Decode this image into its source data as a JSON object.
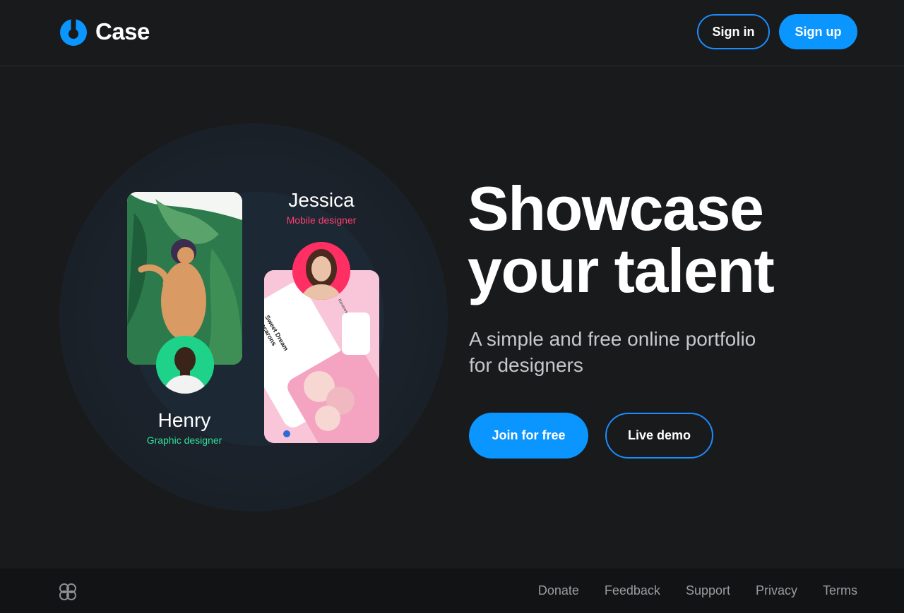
{
  "brand": {
    "name": "Case",
    "logo_icon": "case-logo-icon",
    "accent": "#0a95ff"
  },
  "header": {
    "signin_label": "Sign in",
    "signup_label": "Sign up"
  },
  "hero": {
    "headline_line1": "Showcase",
    "headline_line2": "your talent",
    "subhead_line1": "A simple and free online portfolio",
    "subhead_line2": "for designers",
    "join_label": "Join for free",
    "demo_label": "Live demo",
    "people": [
      {
        "name": "Jessica",
        "role": "Mobile designer",
        "role_color": "#ff3e6f"
      },
      {
        "name": "Henry",
        "role": "Graphic designer",
        "role_color": "#2fe39a"
      }
    ],
    "card_right_text": "Sweet Dream Macarons",
    "card_right_side": "Reviews"
  },
  "footer": {
    "links": [
      "Donate",
      "Feedback",
      "Support",
      "Privacy",
      "Terms"
    ]
  }
}
